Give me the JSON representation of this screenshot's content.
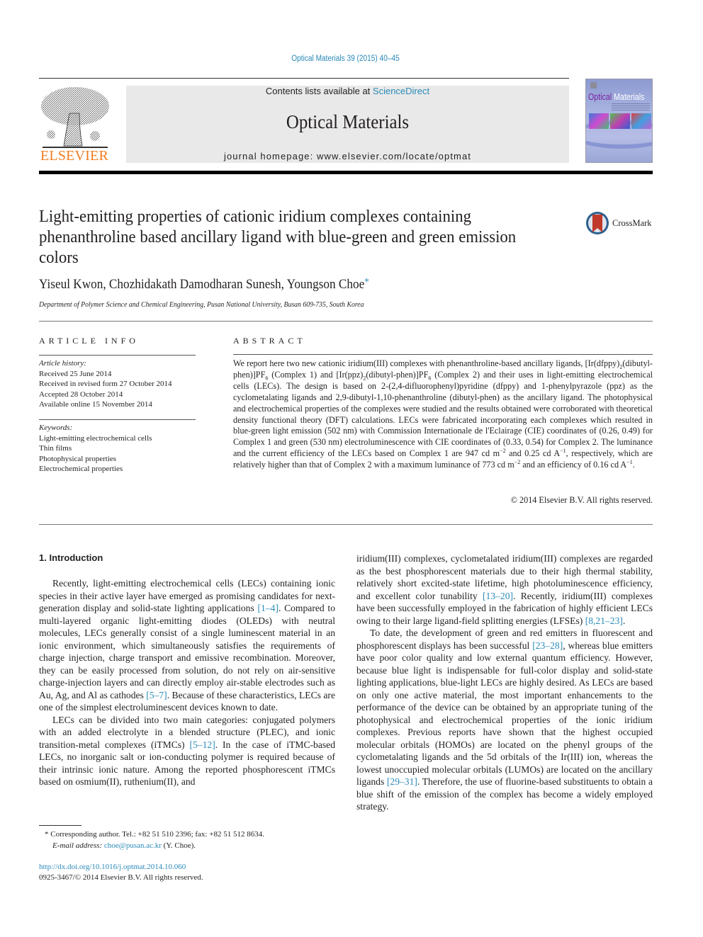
{
  "header": {
    "journal_ref": "Optical Materials 39 (2015) 40–45",
    "contents_prefix": "Contents lists available at ",
    "contents_link": "ScienceDirect",
    "journal_name": "Optical Materials",
    "homepage_label": "journal homepage: www.elsevier.com/locate/optmat",
    "publisher_logo_text": "ELSEVIER",
    "cover": {
      "title_a": "Optical",
      "title_b": " Materials"
    },
    "colors": {
      "link": "#2a8ab8",
      "elsevier_orange": "#f07c1f",
      "masthead_bg": "#e9e9e9"
    }
  },
  "article": {
    "title": "Light-emitting properties of cationic iridium complexes containing phenanthroline based ancillary ligand with blue-green and green emission colors",
    "crossmark_label": "CrossMark",
    "authors": "Yiseul Kwon, Chozhidakath Damodharan Sunesh, Youngson Choe",
    "corresponding_mark": "*",
    "affiliation": "Department of Polymer Science and Chemical Engineering, Pusan National University, Busan 609-735, South Korea"
  },
  "article_info": {
    "heading": "ARTICLE INFO",
    "history_label": "Article history:",
    "history": [
      "Received 25 June 2014",
      "Received in revised form 27 October 2014",
      "Accepted 28 October 2014",
      "Available online 15 November 2014"
    ],
    "keywords_label": "Keywords:",
    "keywords": [
      "Light-emitting electrochemical cells",
      "Thin films",
      "Photophysical properties",
      "Electrochemical properties"
    ]
  },
  "abstract": {
    "heading": "ABSTRACT",
    "parts": {
      "p1": "We report here two new cationic iridium(III) complexes with phenanthroline-based ancillary ligands, [Ir(dfppy)",
      "s1": "2",
      "p2": "(dibutyl-phen)]PF",
      "s2": "6",
      "p3": " (Complex 1) and [Ir(ppz)",
      "s3": "2",
      "p4": "(dibutyl-phen)]PF",
      "s4": "6",
      "p5": " (Complex 2) and their uses in light-emitting electrochemical cells (LECs). The design is based on 2-(2,4-difluorophenyl)pyridine (dfppy) and 1-phenylpyrazole (ppz) as the cyclometalating ligands and 2,9-dibutyl-1,10-phenanthroline (dibutyl-phen) as the ancillary ligand. The photophysical and electrochemical properties of the complexes were studied and the results obtained were corroborated with theoretical density functional theory (DFT) calculations. LECs were fabricated incorporating each complexes which resulted in blue-green light emission (502 nm) with Commission Internationale de l'Eclairage (CIE) coordinates of (0.26, 0.49) for Complex 1 and green (530 nm) electroluminescence with CIE coordinates of (0.33, 0.54) for Complex 2. The luminance and the current efficiency of the LECs based on Complex 1 are 947 cd m",
      "e1": "−2",
      "p6": " and 0.25 cd A",
      "e2": "−1",
      "p7": ", respectively, which are relatively higher than that of Complex 2 with a maximum luminance of 773 cd m",
      "e3": "−2",
      "p8": " and an efficiency of 0.16 cd A",
      "e4": "−1",
      "p9": "."
    },
    "copyright": "© 2014 Elsevier B.V. All rights reserved."
  },
  "body": {
    "section_heading": "1. Introduction",
    "left": {
      "para1": {
        "t1": "Recently, light-emitting electrochemical cells (LECs) containing ionic species in their active layer have emerged as promising candidates for next-generation display and solid-state lighting applications ",
        "r1": "[1–4]",
        "t2": ". Compared to multi-layered organic light-emitting diodes (OLEDs) with neutral molecules, LECs generally consist of a single luminescent material in an ionic environment, which simultaneously satisfies the requirements of charge injection, charge transport and emissive recombination. Moreover, they can be easily processed from solution, do not rely on air-sensitive charge-injection layers and can directly employ air-stable electrodes such as Au, Ag, and Al as cathodes ",
        "r2": "[5–7]",
        "t3": ". Because of these characteristics, LECs are one of the simplest electroluminescent devices known to date."
      },
      "para2": {
        "t1": "LECs can be divided into two main categories: conjugated polymers with an added electrolyte in a blended structure (PLEC), and ionic transition-metal complexes (iTMCs) ",
        "r1": "[5–12]",
        "t2": ". In the case of iTMC-based LECs, no inorganic salt or ion-conducting polymer is required because of their intrinsic ionic nature. Among the reported phosphorescent iTMCs based on osmium(II), ruthenium(II), and"
      }
    },
    "right": {
      "para1": {
        "t1": "iridium(III) complexes, cyclometalated iridium(III) complexes are regarded as the best phosphorescent materials due to their high thermal stability, relatively short excited-state lifetime, high photoluminescence efficiency, and excellent color tunability ",
        "r1": "[13–20]",
        "t2": ". Recently, iridium(III) complexes have been successfully employed in the fabrication of highly efficient LECs owing to their large ligand-field splitting energies (LFSEs) ",
        "r2": "[8,21–23]",
        "t3": "."
      },
      "para2": {
        "t1": "To date, the development of green and red emitters in fluorescent and phosphorescent displays has been successful ",
        "r1": "[23–28]",
        "t2": ", whereas blue emitters have poor color quality and low external quantum efficiency. However, because blue light is indispensable for full-color display and solid-state lighting applications, blue-light LECs are highly desired. As LECs are based on only one active material, the most important enhancements to the performance of the device can be obtained by an appropriate tuning of the photophysical and electrochemical properties of the ionic iridium complexes. Previous reports have shown that the highest occupied molecular orbitals (HOMOs) are located on the phenyl groups of the cyclometalating ligands and the 5d orbitals of the Ir(III) ion, whereas the lowest unoccupied molecular orbitals (LUMOs) are located on the ancillary ligands ",
        "r2": "[29–31]",
        "t3": ". Therefore, the use of fluorine-based substituents to obtain a blue shift of the emission of the complex has become a widely employed strategy."
      }
    }
  },
  "footnote": {
    "mark": "*",
    "corresponding": " Corresponding author. Tel.: +82 51 510 2396; fax: +82 51 512 8634.",
    "email_label": "E-mail address:",
    "email": "choe@pusan.ac.kr",
    "email_suffix": " (Y. Choe).",
    "doi": "http://dx.doi.org/10.1016/j.optmat.2014.10.060",
    "issn": "0925-3467/© 2014 Elsevier B.V. All rights reserved."
  }
}
